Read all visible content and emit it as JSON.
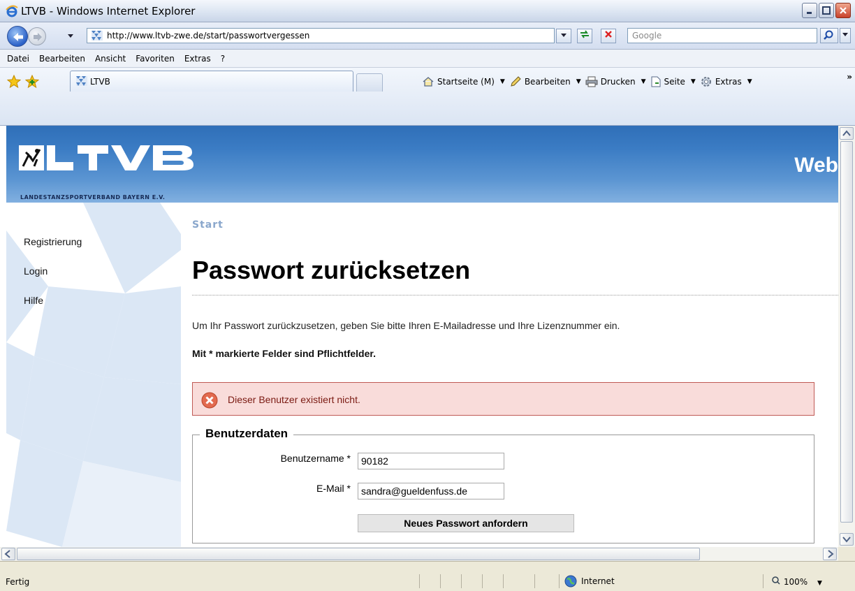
{
  "window": {
    "title": "LTVB - Windows Internet Explorer"
  },
  "address_bar": {
    "url": "http://www.ltvb-zwe.de/start/passwortvergessen",
    "search_placeholder": "Google"
  },
  "menu": {
    "items": [
      "Datei",
      "Bearbeiten",
      "Ansicht",
      "Favoriten",
      "Extras",
      "?"
    ],
    "underline_chars": [
      "D",
      "B",
      "A",
      "F",
      "t",
      "?"
    ]
  },
  "tabs": {
    "active_tab_title": "LTVB"
  },
  "command_bar": {
    "home": "Startseite (M)",
    "edit": "Bearbeiten",
    "print": "Drucken",
    "page": "Seite",
    "tools": "Extras"
  },
  "site": {
    "logo_subtitle": "LANDESTANZSPORTVERBAND BAYERN E.V.",
    "header_right": "Web",
    "sidebar_links": [
      "Registrierung",
      "Login",
      "Hilfe"
    ],
    "breadcrumb": "Start",
    "page_title": "Passwort zurücksetzen",
    "intro_text": "Um Ihr Passwort zurückzusetzen, geben Sie bitte Ihren E-Mailadresse und Ihre Lizenznummer ein.",
    "required_note": "Mit * markierte Felder sind Pflichtfelder.",
    "error_message": "Dieser Benutzer existiert nicht.",
    "form": {
      "legend": "Benutzerdaten",
      "username_label": "Benutzername *",
      "username_value": "90182",
      "email_label": "E-Mail *",
      "email_value": "sandra@gueldenfuss.de",
      "submit_label": "Neues Passwort anfordern"
    }
  },
  "status_bar": {
    "status": "Fertig",
    "zone": "Internet",
    "zoom": "100%"
  },
  "colors": {
    "header_blue": "#3b7cc4",
    "error_bg": "#f9dcda",
    "error_border": "#c05a55",
    "breadcrumb": "#8aa7cc"
  }
}
